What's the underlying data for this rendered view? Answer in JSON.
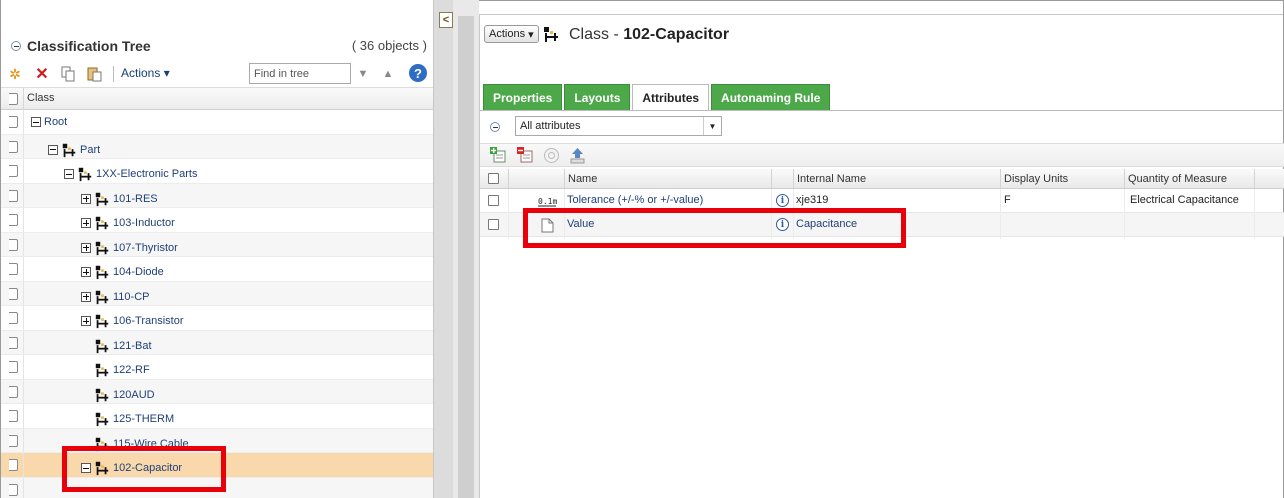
{
  "left_panel": {
    "title": "Classification Tree",
    "object_count": "( 36 objects )",
    "toolbar": {
      "actions_label": "Actions",
      "find_placeholder": "Find in tree",
      "help_label": "?"
    },
    "column_header": "Class",
    "tree": [
      {
        "label": "Root",
        "level": 0,
        "expander": "minus",
        "icon": false
      },
      {
        "label": "Part",
        "level": 1,
        "expander": "minus",
        "icon": true
      },
      {
        "label": "1XX-Electronic Parts",
        "level": 2,
        "expander": "minus",
        "icon": true
      },
      {
        "label": "101-RES",
        "level": 3,
        "expander": "plus",
        "icon": true
      },
      {
        "label": "103-Inductor",
        "level": 3,
        "expander": "plus",
        "icon": true
      },
      {
        "label": "107-Thyristor",
        "level": 3,
        "expander": "plus",
        "icon": true
      },
      {
        "label": "104-Diode",
        "level": 3,
        "expander": "plus",
        "icon": true
      },
      {
        "label": "110-CP",
        "level": 3,
        "expander": "plus",
        "icon": true
      },
      {
        "label": "106-Transistor",
        "level": 3,
        "expander": "plus",
        "icon": true
      },
      {
        "label": "121-Bat",
        "level": 3,
        "expander": "none",
        "icon": true
      },
      {
        "label": "122-RF",
        "level": 3,
        "expander": "none",
        "icon": true
      },
      {
        "label": "120AUD",
        "level": 3,
        "expander": "none",
        "icon": true
      },
      {
        "label": "125-THERM",
        "level": 3,
        "expander": "none",
        "icon": true
      },
      {
        "label": "115-Wire Cable",
        "level": 3,
        "expander": "none",
        "icon": true
      },
      {
        "label": "102-Capacitor",
        "level": 3,
        "expander": "minus",
        "icon": true,
        "selected": true
      }
    ]
  },
  "right_panel": {
    "actions_label": "Actions",
    "title_prefix": "Class - ",
    "title_name": "102-Capacitor",
    "tabs": [
      {
        "label": "Properties",
        "active": false
      },
      {
        "label": "Layouts",
        "active": false
      },
      {
        "label": "Attributes",
        "active": true
      },
      {
        "label": "Autonaming Rule",
        "active": false
      }
    ],
    "filter_value": "All attributes",
    "grid": {
      "columns": [
        "Name",
        "Internal Name",
        "Display Units",
        "Quantity of Measure"
      ],
      "rows": [
        {
          "type_icon": "0.1m",
          "name": "Tolerance (+/-% or +/-value)",
          "internal_name": "xje319",
          "display_units": "F",
          "quantity": "Electrical Capacitance"
        },
        {
          "type_icon": "string",
          "name": "Value",
          "internal_name": "Capacitance",
          "display_units": "",
          "quantity": ""
        }
      ]
    }
  },
  "icons": {
    "info": "i",
    "collapse_left": "<"
  },
  "colors": {
    "tab_green": "#4da84a",
    "selection": "#f9d9ab",
    "highlight_red": "#e8000b",
    "link_blue": "#1f3f78"
  }
}
